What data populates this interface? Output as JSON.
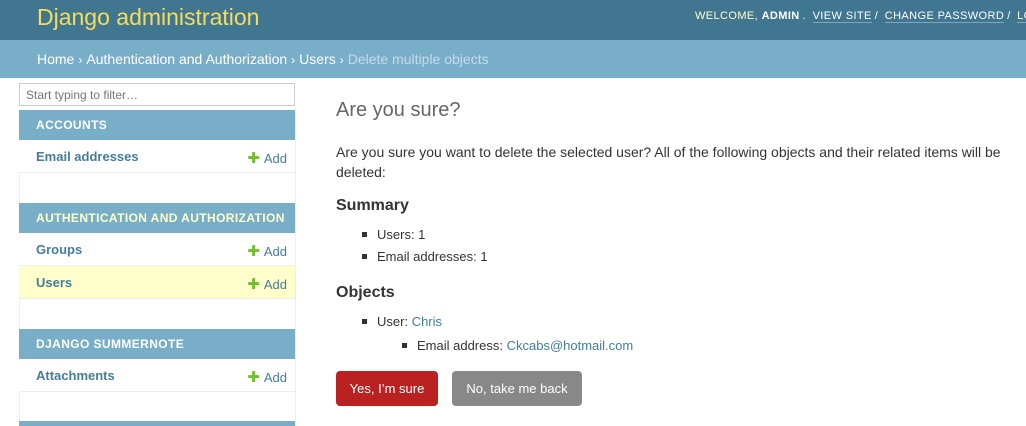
{
  "header": {
    "branding": "Django administration",
    "welcome": "WELCOME,",
    "username": "ADMIN",
    "view_site": "VIEW SITE",
    "change_password": "CHANGE PASSWORD",
    "log_out": "LOG OU"
  },
  "breadcrumbs": {
    "home": "Home",
    "app": "Authentication and Authorization",
    "model": "Users",
    "current": "Delete multiple objects"
  },
  "sidebar": {
    "filter_placeholder": "Start typing to filter…",
    "modules": [
      {
        "caption": "Accounts",
        "items": [
          {
            "name": "Email addresses",
            "add": "Add"
          }
        ]
      },
      {
        "caption": "Authentication and Authorization",
        "items": [
          {
            "name": "Groups",
            "add": "Add"
          },
          {
            "name": "Users",
            "add": "Add"
          }
        ]
      },
      {
        "caption": "Django Summernote",
        "items": [
          {
            "name": "Attachments",
            "add": "Add"
          }
        ]
      }
    ]
  },
  "main": {
    "title": "Are you sure?",
    "question": "Are you sure you want to delete the selected user? All of the following objects and their related items will be deleted:",
    "summary_heading": "Summary",
    "summary": [
      "Users: 1",
      "Email addresses: 1"
    ],
    "objects_heading": "Objects",
    "objects": {
      "user_label": "User:",
      "user_link": "Chris",
      "email_label": "Email address:",
      "email_link": "Ckcabs@hotmail.com"
    },
    "confirm_label": "Yes, I’m sure",
    "cancel_label": "No, take me back"
  },
  "colors": {
    "header_bg": "#417690",
    "branding": "#f5dd5d",
    "breadcrumb_bg": "#79aec8",
    "link": "#447e9b",
    "add_plus": "#70bf2b",
    "selected_row": "#ffffcc",
    "delete_button": "#ba2121",
    "cancel_button": "#888888"
  }
}
